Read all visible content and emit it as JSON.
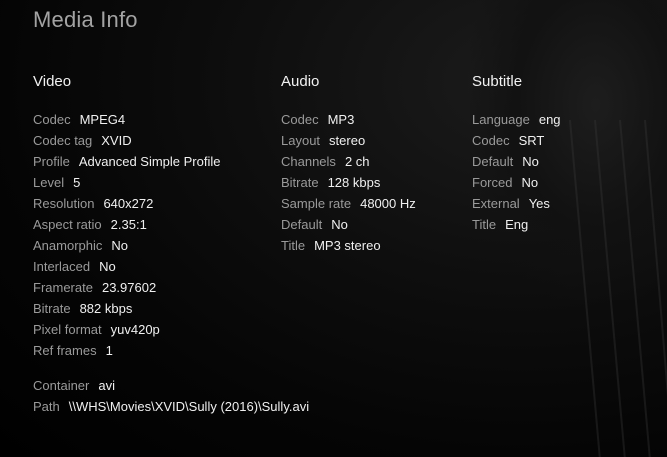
{
  "title": "Media Info",
  "video": {
    "heading": "Video",
    "rows": [
      {
        "label": "Codec",
        "value": "MPEG4"
      },
      {
        "label": "Codec tag",
        "value": "XVID"
      },
      {
        "label": "Profile",
        "value": "Advanced Simple Profile"
      },
      {
        "label": "Level",
        "value": "5"
      },
      {
        "label": "Resolution",
        "value": "640x272"
      },
      {
        "label": "Aspect ratio",
        "value": "2.35:1"
      },
      {
        "label": "Anamorphic",
        "value": "No"
      },
      {
        "label": "Interlaced",
        "value": "No"
      },
      {
        "label": "Framerate",
        "value": "23.97602"
      },
      {
        "label": "Bitrate",
        "value": "882 kbps"
      },
      {
        "label": "Pixel format",
        "value": "yuv420p"
      },
      {
        "label": "Ref frames",
        "value": "1"
      }
    ]
  },
  "audio": {
    "heading": "Audio",
    "rows": [
      {
        "label": "Codec",
        "value": "MP3"
      },
      {
        "label": "Layout",
        "value": "stereo"
      },
      {
        "label": "Channels",
        "value": "2 ch"
      },
      {
        "label": "Bitrate",
        "value": "128 kbps"
      },
      {
        "label": "Sample rate",
        "value": "48000 Hz"
      },
      {
        "label": "Default",
        "value": "No"
      },
      {
        "label": "Title",
        "value": "MP3 stereo"
      }
    ]
  },
  "subtitle": {
    "heading": "Subtitle",
    "rows": [
      {
        "label": "Language",
        "value": "eng"
      },
      {
        "label": "Codec",
        "value": "SRT"
      },
      {
        "label": "Default",
        "value": "No"
      },
      {
        "label": "Forced",
        "value": "No"
      },
      {
        "label": "External",
        "value": "Yes"
      },
      {
        "label": "Title",
        "value": "Eng"
      }
    ]
  },
  "file": {
    "rows": [
      {
        "label": "Container",
        "value": "avi"
      },
      {
        "label": "Path",
        "value": "\\\\WHS\\Movies\\XVID\\Sully (2016)\\Sully.avi"
      }
    ]
  }
}
